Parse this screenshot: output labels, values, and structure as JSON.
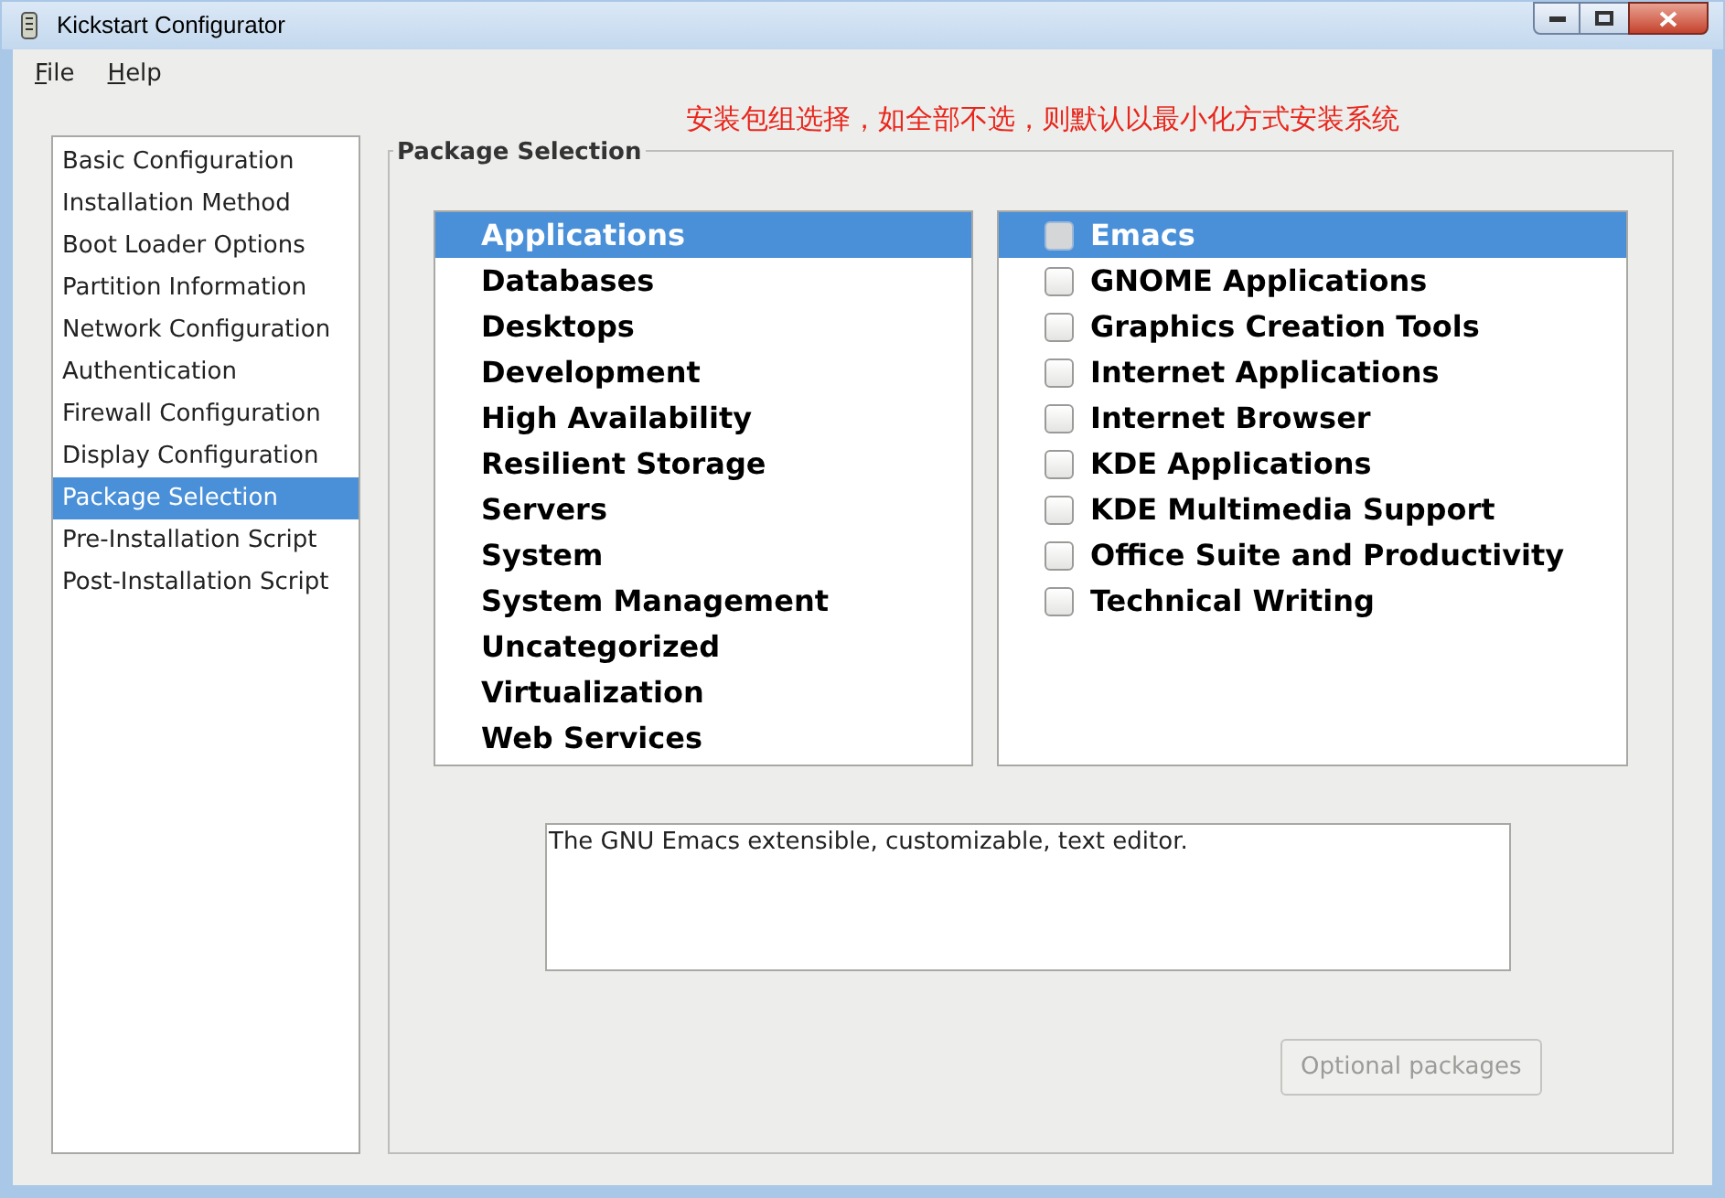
{
  "window": {
    "title": "Kickstart Configurator"
  },
  "menu": [
    {
      "label": "File"
    },
    {
      "label": "Help"
    }
  ],
  "annotation": "安装包组选择，如全部不选，则默认以最小化方式安装系统",
  "sidebar": {
    "items": [
      {
        "label": "Basic Configuration",
        "selected": false
      },
      {
        "label": "Installation Method",
        "selected": false
      },
      {
        "label": "Boot Loader Options",
        "selected": false
      },
      {
        "label": "Partition Information",
        "selected": false
      },
      {
        "label": "Network Configuration",
        "selected": false
      },
      {
        "label": "Authentication",
        "selected": false
      },
      {
        "label": "Firewall Configuration",
        "selected": false
      },
      {
        "label": "Display Configuration",
        "selected": false
      },
      {
        "label": "Package Selection",
        "selected": true
      },
      {
        "label": "Pre-Installation Script",
        "selected": false
      },
      {
        "label": "Post-Installation Script",
        "selected": false
      }
    ]
  },
  "panel": {
    "title": "Package Selection",
    "groups": [
      {
        "label": "Applications",
        "selected": true
      },
      {
        "label": "Databases",
        "selected": false
      },
      {
        "label": "Desktops",
        "selected": false
      },
      {
        "label": "Development",
        "selected": false
      },
      {
        "label": "High Availability",
        "selected": false
      },
      {
        "label": "Resilient Storage",
        "selected": false
      },
      {
        "label": "Servers",
        "selected": false
      },
      {
        "label": "System",
        "selected": false
      },
      {
        "label": "System Management",
        "selected": false
      },
      {
        "label": "Uncategorized",
        "selected": false
      },
      {
        "label": "Virtualization",
        "selected": false
      },
      {
        "label": "Web Services",
        "selected": false
      }
    ],
    "packages": [
      {
        "label": "Emacs",
        "selected": true,
        "checked": false
      },
      {
        "label": "GNOME Applications",
        "selected": false,
        "checked": false
      },
      {
        "label": "Graphics Creation Tools",
        "selected": false,
        "checked": false
      },
      {
        "label": "Internet Applications",
        "selected": false,
        "checked": false
      },
      {
        "label": "Internet Browser",
        "selected": false,
        "checked": false
      },
      {
        "label": "KDE Applications",
        "selected": false,
        "checked": false
      },
      {
        "label": "KDE Multimedia Support",
        "selected": false,
        "checked": false
      },
      {
        "label": "Office Suite and Productivity",
        "selected": false,
        "checked": false
      },
      {
        "label": "Technical Writing",
        "selected": false,
        "checked": false
      }
    ],
    "description": "The GNU Emacs extensible, customizable, text editor.",
    "optional_button": {
      "label": "Optional packages",
      "disabled": true
    }
  }
}
